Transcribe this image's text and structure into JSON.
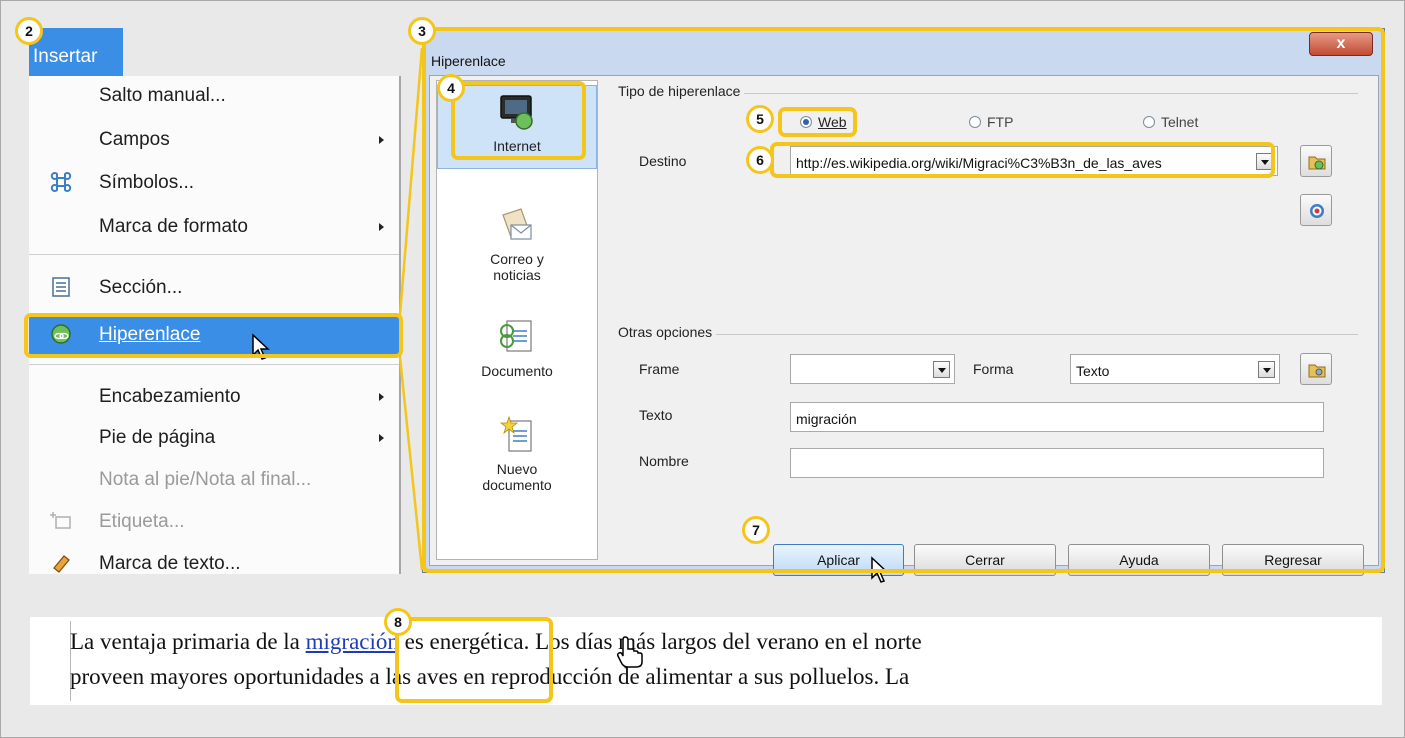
{
  "menu": {
    "title": "Insertar",
    "items": [
      {
        "label": "Salto manual...",
        "submenu": false,
        "disabled": false
      },
      {
        "label": "Campos",
        "submenu": true,
        "disabled": false
      },
      {
        "label": "Símbolos...",
        "submenu": false,
        "disabled": false,
        "icon": "cmd-symbol-icon"
      },
      {
        "label": "Marca de formato",
        "submenu": true,
        "disabled": false
      },
      {
        "label": "Sección...",
        "submenu": false,
        "disabled": false,
        "icon": "section-icon"
      },
      {
        "label": "Hiperenlace",
        "submenu": false,
        "disabled": false,
        "icon": "hyperlink-globe-icon",
        "highlighted": true
      },
      {
        "label": "Encabezamiento",
        "submenu": true,
        "disabled": false
      },
      {
        "label": "Pie de página",
        "submenu": true,
        "disabled": false
      },
      {
        "label": "Nota al pie/Nota al final...",
        "submenu": false,
        "disabled": true
      },
      {
        "label": "Etiqueta...",
        "submenu": false,
        "disabled": true,
        "icon": "caption-icon"
      },
      {
        "label": "Marca de texto...",
        "submenu": false,
        "disabled": false,
        "icon": "bookmark-icon"
      }
    ]
  },
  "dialog": {
    "title": "Hiperenlace",
    "close_label": "x",
    "categories": [
      {
        "label": "Internet",
        "icon": "internet-globe-icon",
        "selected": true
      },
      {
        "label": "Correo y\nnoticias",
        "icon": "mail-icon",
        "selected": false
      },
      {
        "label": "Documento",
        "icon": "document-link-icon",
        "selected": false
      },
      {
        "label": "Nuevo\ndocumento",
        "icon": "new-document-icon",
        "selected": false
      }
    ],
    "link_type": {
      "label": "Tipo de hiperenlace",
      "options": [
        "Web",
        "FTP",
        "Telnet"
      ],
      "selected": "Web"
    },
    "target": {
      "label": "Destino",
      "value": "http://es.wikipedia.org/wiki/Migraci%C3%B3n_de_las_aves"
    },
    "other_options": {
      "label": "Otras opciones",
      "frame_label": "Frame",
      "frame_value": "",
      "form_label": "Forma",
      "form_value": "Texto",
      "text_label": "Texto",
      "text_value": "migración",
      "name_label": "Nombre",
      "name_value": ""
    },
    "buttons": {
      "apply": "Aplicar",
      "close": "Cerrar",
      "help": "Ayuda",
      "back": "Regresar"
    }
  },
  "callouts": [
    "2",
    "3",
    "4",
    "5",
    "6",
    "7",
    "8"
  ],
  "document": {
    "line1_before": "La ventaja primaria de la ",
    "line1_link": "migración",
    "line1_after": " es energética. Los días más largos del verano en el norte",
    "line2": "proveen mayores oportunidades a las aves en reproducción de alimentar a sus polluelos. La"
  },
  "colors": {
    "accent": "#3a8ee6",
    "callout": "#f4c51b",
    "link": "#1f3bb8"
  }
}
